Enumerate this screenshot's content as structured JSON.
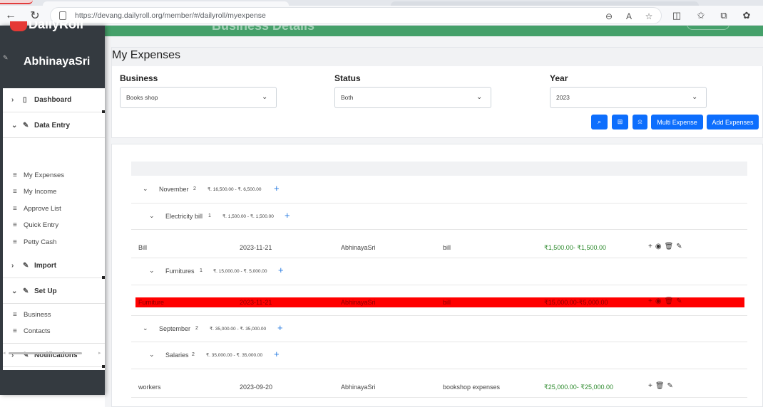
{
  "browser": {
    "url": "https://devang.dailyroll.org/member/#/dailyroll/myexpense"
  },
  "app": {
    "logo_text": "DailyRoll",
    "user_name": "AbhinayaSri",
    "top_banner_title": "Business Details"
  },
  "sidebar": {
    "sections": [
      {
        "label": "Dashboard",
        "chevron": "›",
        "icon": "page-icon"
      },
      {
        "label": "Data Entry",
        "chevron": "⌄",
        "icon": "pencil-icon"
      },
      {
        "label": "Import",
        "chevron": "›",
        "icon": "pencil-icon"
      },
      {
        "label": "Set Up",
        "chevron": "⌄",
        "icon": "pencil-icon"
      },
      {
        "label": "Notifications",
        "chevron": "›",
        "icon": "pencil-icon"
      }
    ],
    "data_entry_items": [
      "My Expenses",
      "My Income",
      "Approve List",
      "Quick Entry",
      "Petty Cash"
    ],
    "setup_items": [
      "Business",
      "Contacts"
    ]
  },
  "page": {
    "title": "My Expenses",
    "filters": {
      "business_label": "Business",
      "business_value": "Books shop",
      "status_label": "Status",
      "status_value": "Both",
      "year_label": "Year",
      "year_value": "2023"
    },
    "buttons": {
      "multi_expense": "Multi Expense",
      "add_expenses": "Add Expenses"
    }
  },
  "groups": {
    "november": {
      "name": "November",
      "count": "2",
      "range": "₹. 16,500.00 - ₹. 6,500.00"
    },
    "electricity": {
      "name": "Electricity bill",
      "count": "1",
      "range": "₹. 1,500.00 - ₹. 1,500.00"
    },
    "furnitures": {
      "name": "Furnitures",
      "count": "1",
      "range": "₹. 15,000.00 - ₹. 5,000.00"
    },
    "september": {
      "name": "September",
      "count": "2",
      "range": "₹. 35,000.00 - ₹. 35,000.00"
    },
    "salaries": {
      "name": "Salaries",
      "count": "2",
      "range": "₹. 35,000.00 - ₹. 35,000.00"
    }
  },
  "rows": [
    {
      "title": "Bill",
      "date": "2023-11-21",
      "user": "AbhinayaSri",
      "note": "bill",
      "amount": "₹1,500.00- ₹1,500.00",
      "highlighted": false
    },
    {
      "title": "Furniture",
      "date": "2023-11-21",
      "user": "AbhinayaSri",
      "note": "bill",
      "amount": "₹15,000.00-₹5,000.00",
      "highlighted": true
    },
    {
      "title": "workers",
      "date": "2023-09-20",
      "user": "AbhinayaSri",
      "note": "bookshop expenses",
      "amount": "₹25,000.00- ₹25,000.00",
      "highlighted": false
    }
  ],
  "colors": {
    "sidebar_bg": "#343a40",
    "banner_green": "#45a06a",
    "primary_button": "#0d6efd",
    "highlight_row": "#ff0000",
    "amount_green": "#2e8b2e"
  }
}
